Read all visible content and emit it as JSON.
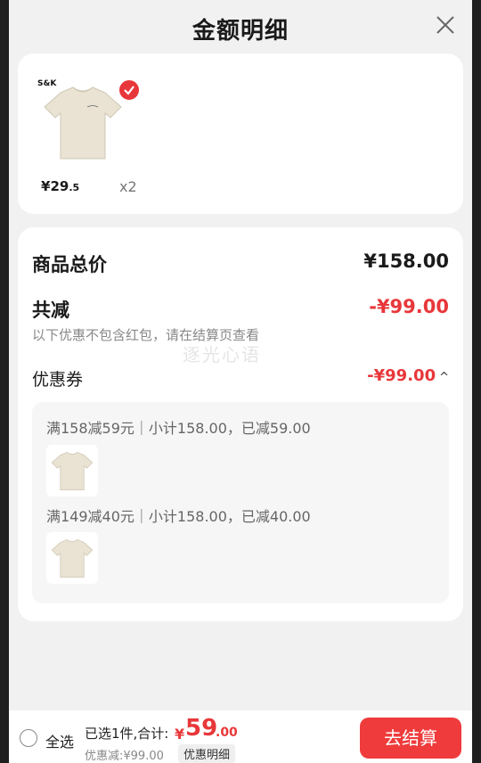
{
  "header": {
    "title": "金额明细",
    "close_icon": "close-icon"
  },
  "product": {
    "brand_text": "S&K",
    "price_symbol": "¥",
    "price_int": "29",
    "price_dec": ".5",
    "quantity": "x2",
    "selected": true,
    "check_color": "#e8373a"
  },
  "summary": {
    "total_label": "商品总价",
    "total_value": "¥158.00",
    "discount_label": "共减",
    "discount_value": "-¥99.00",
    "note": "以下优惠不包含红包，请在结算页查看",
    "watermark": "逐光心语",
    "coupon_label": "优惠券",
    "coupon_value": "-¥99.00",
    "coupon_caret": "^"
  },
  "coupons": [
    {
      "title": "满158减59元｜小计158.00，已减59.00"
    },
    {
      "title": "满149减40元｜小计158.00，已减40.00"
    }
  ],
  "bottom": {
    "select_all": "全选",
    "selected_text": "已选1件,合计:",
    "total_symbol": "¥",
    "total_int": "59",
    "total_dec": ".00",
    "discount_text": "优惠减:¥99.00",
    "detail_tag": "优惠明细",
    "checkout": "去结算"
  },
  "colors": {
    "accent_red": "#e8373a",
    "checkout_bg": "#ef3b3b"
  }
}
